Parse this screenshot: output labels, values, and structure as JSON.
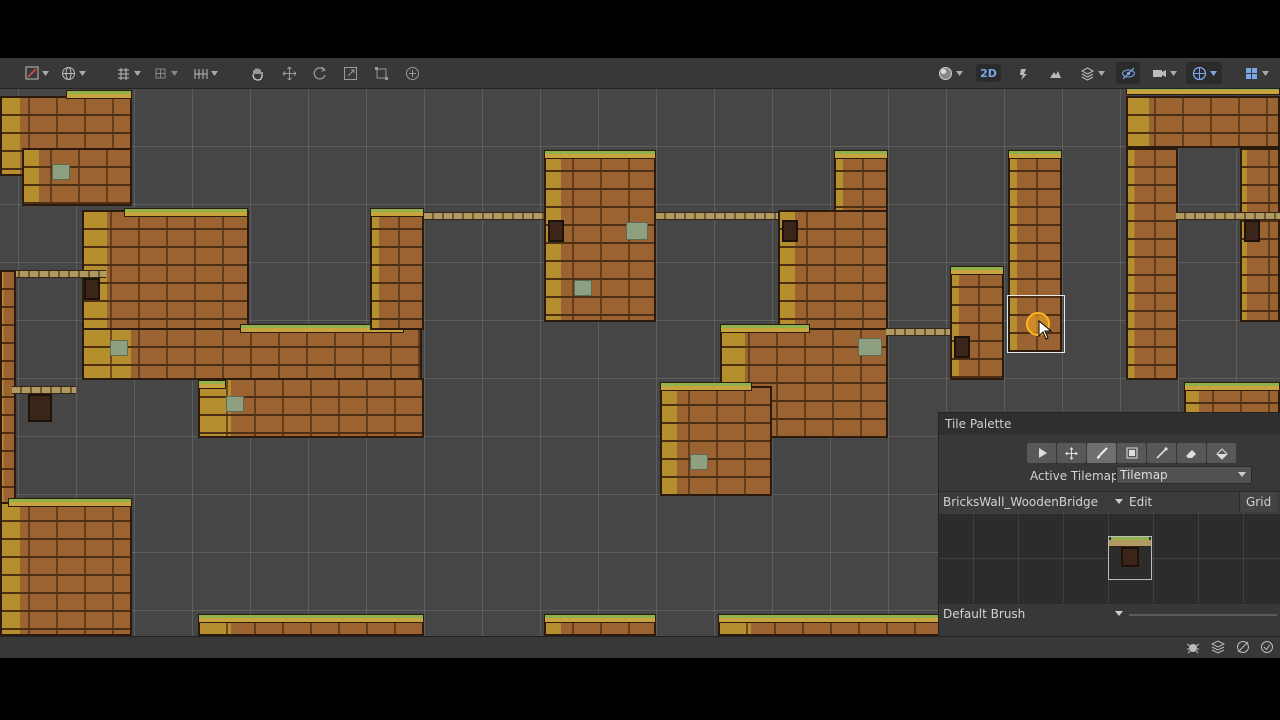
{
  "scene": {
    "toolbar": {
      "tools": [
        "hand-tool",
        "move-tool",
        "rotate-tool",
        "scale-tool",
        "rect-tool",
        "transform-tool"
      ],
      "view_2d_label": "2D"
    }
  },
  "tile_palette": {
    "title": "Tile Palette",
    "tools": [
      "select",
      "move",
      "paint",
      "box-fill",
      "pick",
      "erase",
      "flood-fill"
    ],
    "active_tool": "paint",
    "active_tilemap_label": "Active Tilemap",
    "active_tilemap_value": "Tilemap",
    "palette_name": "BricksWall_WoodenBridge",
    "edit_label": "Edit",
    "grid_label": "Grid",
    "brush_label": "Default Brush"
  },
  "colors": {
    "brick": "#9a6331",
    "moss": "#8fb24a",
    "scene_bg": "#464646",
    "selection_ring": "#ffb626"
  }
}
